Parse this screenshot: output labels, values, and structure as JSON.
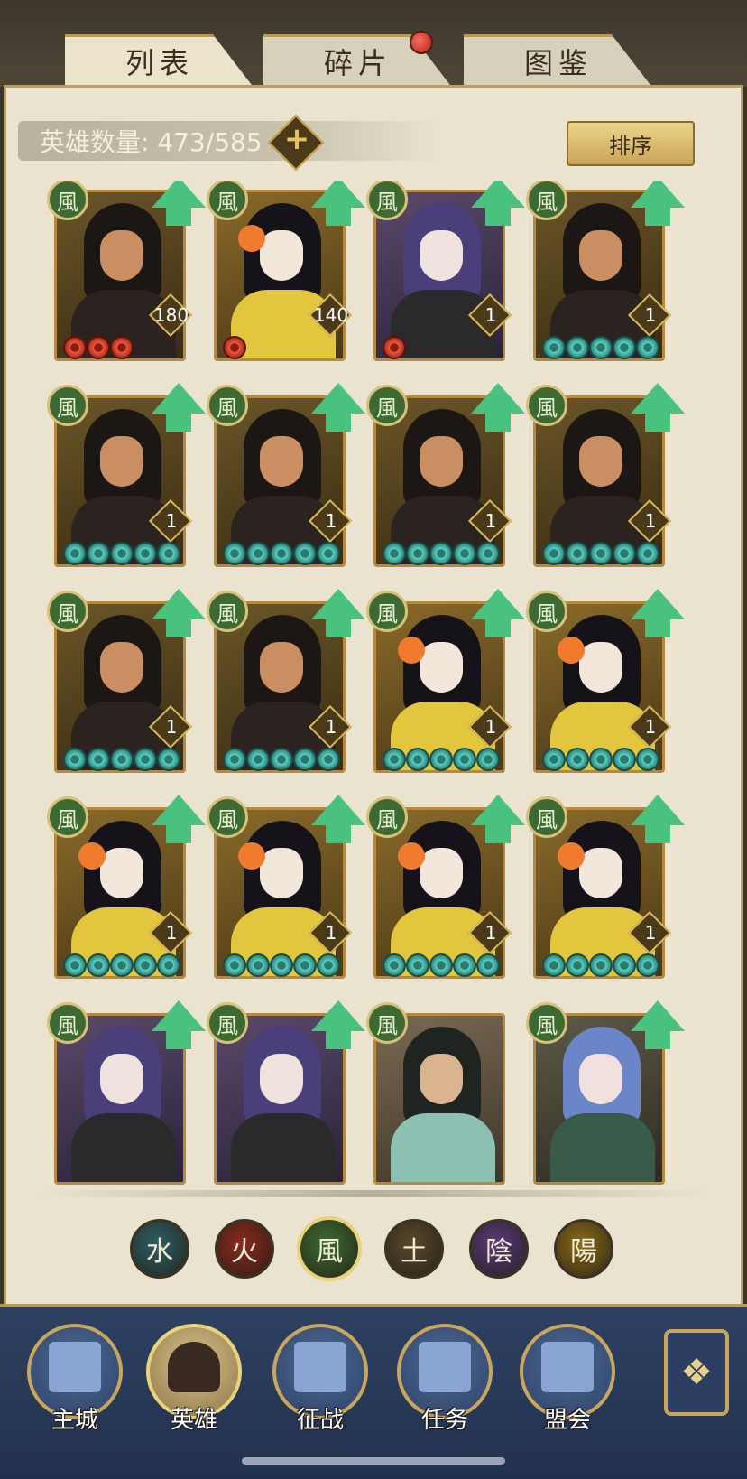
{
  "tabs": [
    {
      "label": "列表",
      "active": true
    },
    {
      "label": "碎片",
      "active": false,
      "badge": true
    },
    {
      "label": "图鉴",
      "active": false
    }
  ],
  "header": {
    "counter_label": "英雄数量:",
    "counter_value": "473/585",
    "plus_icon": "+",
    "sort_label": "排序"
  },
  "heroes": [
    {
      "type": "a",
      "attr": "風",
      "level": "180",
      "stars": [
        "red",
        "red",
        "red"
      ]
    },
    {
      "type": "b",
      "attr": "風",
      "level": "140",
      "stars": [
        "red"
      ]
    },
    {
      "type": "c",
      "attr": "風",
      "level": "1",
      "stars": [
        "red"
      ]
    },
    {
      "type": "a",
      "attr": "風",
      "level": "1",
      "stars": [
        "teal",
        "teal",
        "teal",
        "teal",
        "teal"
      ]
    },
    {
      "type": "a",
      "attr": "風",
      "level": "1",
      "stars": [
        "teal",
        "teal",
        "teal",
        "teal",
        "teal"
      ]
    },
    {
      "type": "a",
      "attr": "風",
      "level": "1",
      "stars": [
        "teal",
        "teal",
        "teal",
        "teal",
        "teal"
      ]
    },
    {
      "type": "a",
      "attr": "風",
      "level": "1",
      "stars": [
        "teal",
        "teal",
        "teal",
        "teal",
        "teal"
      ]
    },
    {
      "type": "a",
      "attr": "風",
      "level": "1",
      "stars": [
        "teal",
        "teal",
        "teal",
        "teal",
        "teal"
      ]
    },
    {
      "type": "a",
      "attr": "風",
      "level": "1",
      "stars": [
        "teal",
        "teal",
        "teal",
        "teal",
        "teal"
      ]
    },
    {
      "type": "a",
      "attr": "風",
      "level": "1",
      "stars": [
        "teal",
        "teal",
        "teal",
        "teal",
        "teal"
      ]
    },
    {
      "type": "b",
      "attr": "風",
      "level": "1",
      "stars": [
        "teal",
        "teal",
        "teal",
        "teal",
        "teal"
      ]
    },
    {
      "type": "b",
      "attr": "風",
      "level": "1",
      "stars": [
        "teal",
        "teal",
        "teal",
        "teal",
        "teal"
      ]
    },
    {
      "type": "b",
      "attr": "風",
      "level": "1",
      "stars": [
        "teal",
        "teal",
        "teal",
        "teal",
        "teal"
      ]
    },
    {
      "type": "b",
      "attr": "風",
      "level": "1",
      "stars": [
        "teal",
        "teal",
        "teal",
        "teal",
        "teal"
      ]
    },
    {
      "type": "b",
      "attr": "風",
      "level": "1",
      "stars": [
        "teal",
        "teal",
        "teal",
        "teal",
        "teal"
      ]
    },
    {
      "type": "b",
      "attr": "風",
      "level": "1",
      "stars": [
        "teal",
        "teal",
        "teal",
        "teal",
        "teal"
      ]
    },
    {
      "type": "c",
      "attr": "風",
      "level": "",
      "stars": []
    },
    {
      "type": "c",
      "attr": "風",
      "level": "",
      "stars": []
    },
    {
      "type": "d",
      "attr": "風",
      "level": "",
      "stars": []
    },
    {
      "type": "e",
      "attr": "風",
      "level": "",
      "stars": []
    }
  ],
  "elements": [
    {
      "glyph": "水",
      "color": "#2e5f63",
      "active": false
    },
    {
      "glyph": "火",
      "color": "#8a2a1e",
      "active": false
    },
    {
      "glyph": "風",
      "color": "#3d6a32",
      "active": true
    },
    {
      "glyph": "土",
      "color": "#5a4a2a",
      "active": false
    },
    {
      "glyph": "陰",
      "color": "#5a3a7a",
      "active": false
    },
    {
      "glyph": "陽",
      "color": "#8a6a1a",
      "active": false
    }
  ],
  "nav": [
    {
      "label": "主城",
      "icon": "city-gate-icon"
    },
    {
      "label": "英雄",
      "icon": "hero-portrait-icon",
      "active": true
    },
    {
      "label": "征战",
      "icon": "war-horn-icon"
    },
    {
      "label": "任务",
      "icon": "scroll-bell-icon"
    },
    {
      "label": "盟会",
      "icon": "pavilion-icon"
    }
  ],
  "nav_extra_icon": "❖"
}
